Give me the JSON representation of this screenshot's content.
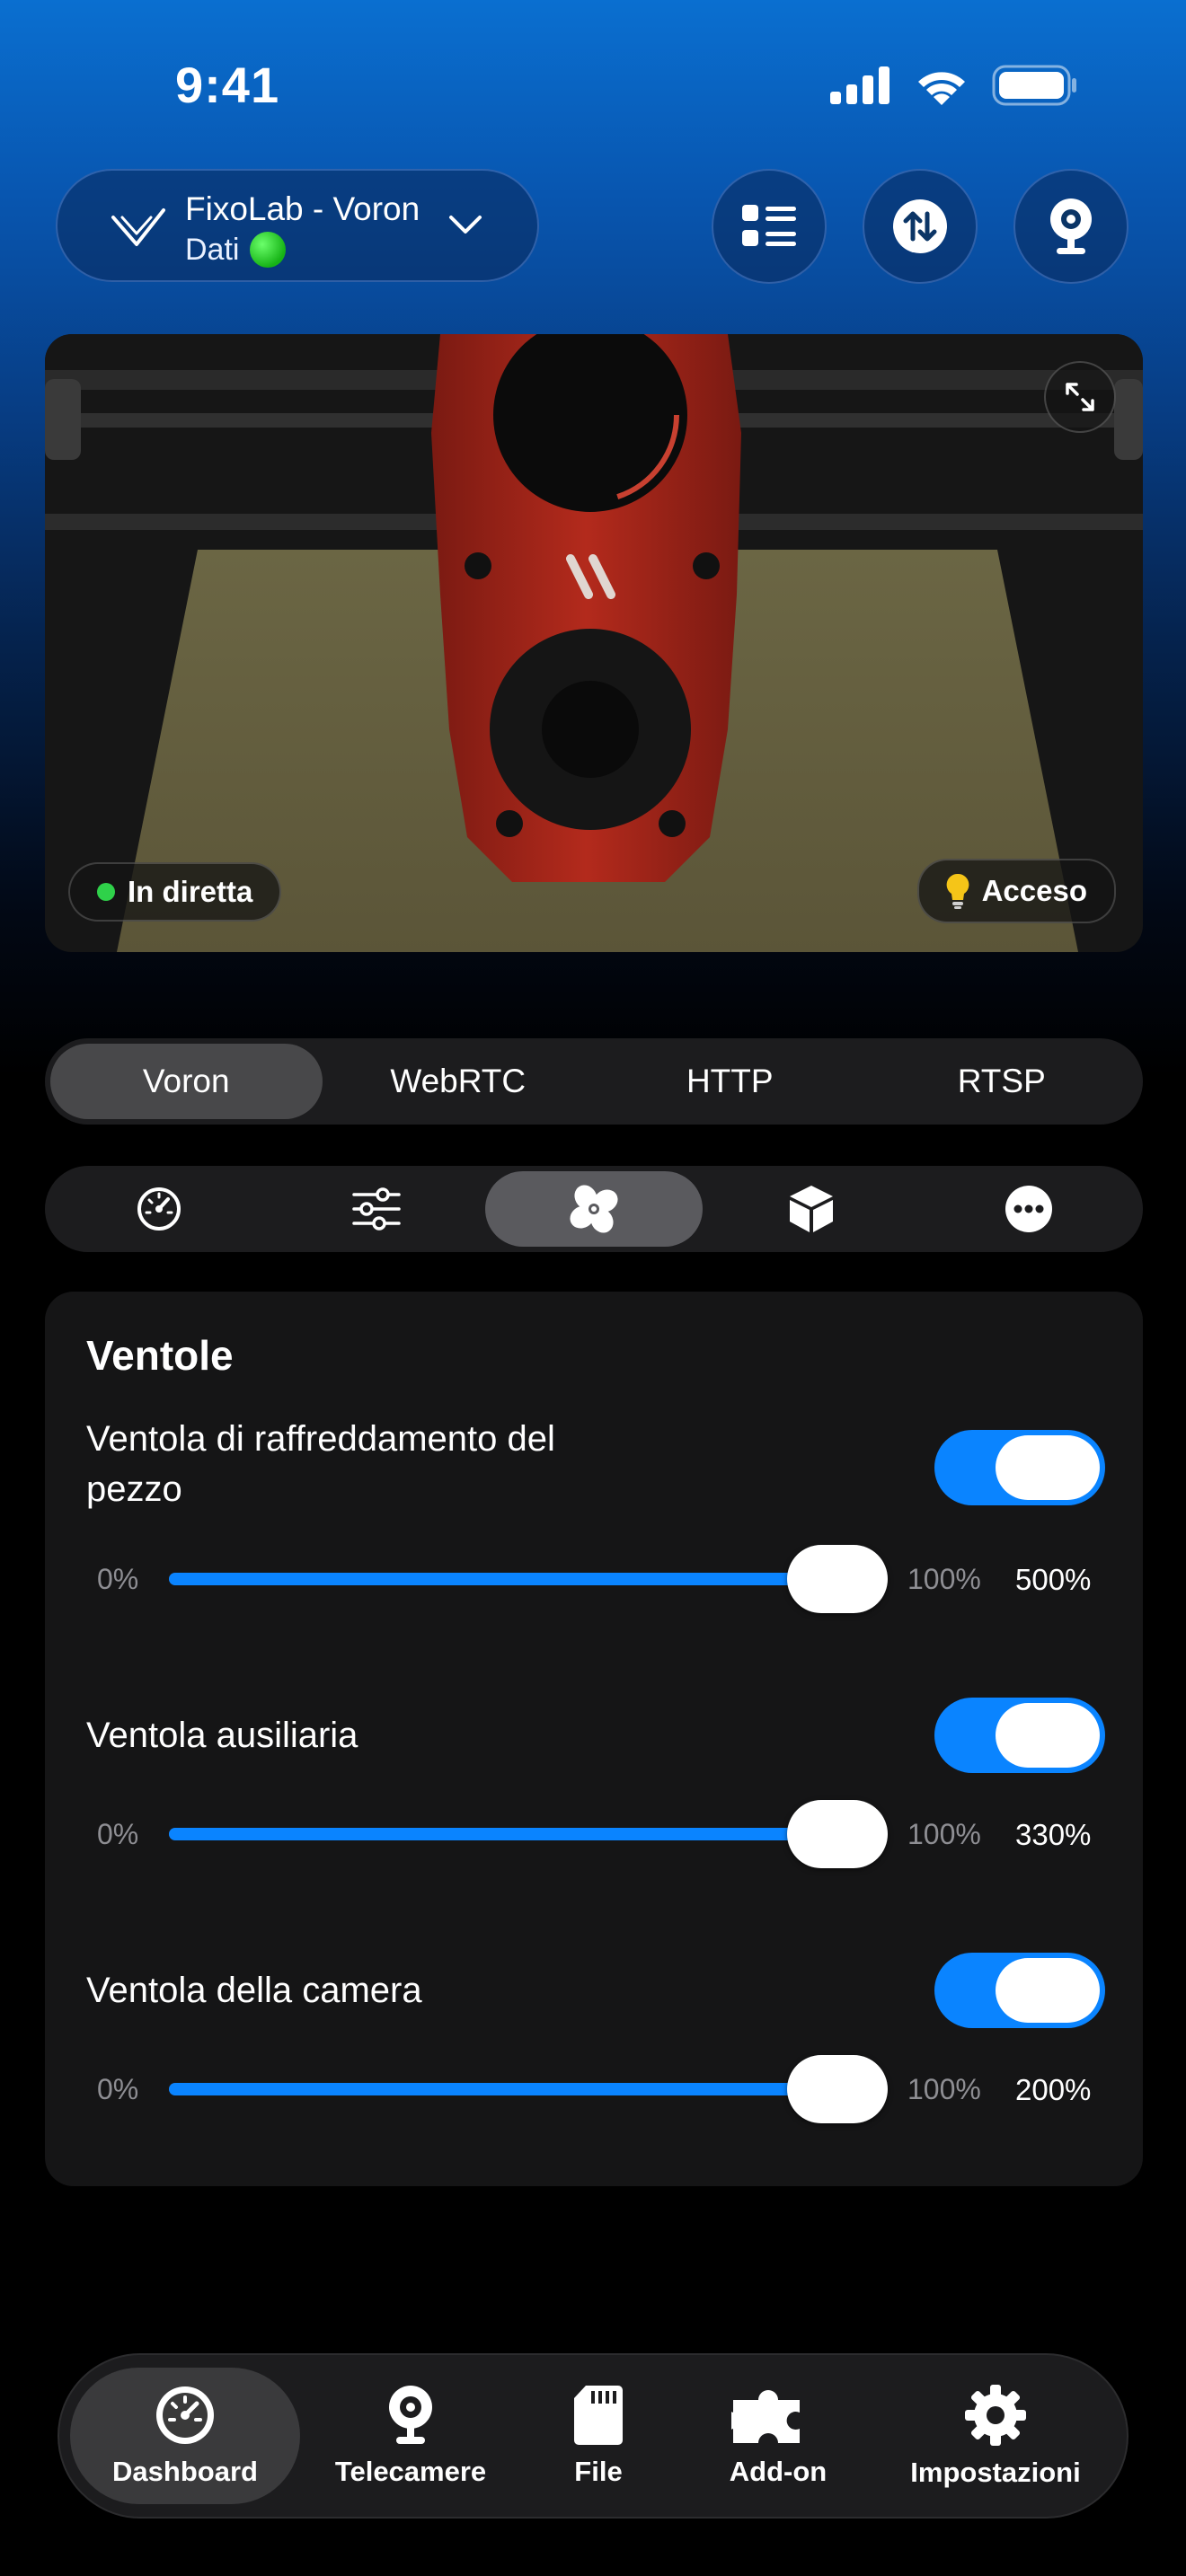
{
  "status_bar": {
    "time": "9:41"
  },
  "header": {
    "printer_name": "FixoLab - Voron",
    "printer_status": "Dati"
  },
  "camera": {
    "live_label": "In diretta",
    "light_label": "Acceso"
  },
  "source_tabs": [
    {
      "label": "Voron",
      "active": true
    },
    {
      "label": "WebRTC",
      "active": false
    },
    {
      "label": "HTTP",
      "active": false
    },
    {
      "label": "RTSP",
      "active": false
    }
  ],
  "section_tabs": [
    {
      "icon": "speedometer-icon",
      "active": false
    },
    {
      "icon": "sliders-icon",
      "active": false
    },
    {
      "icon": "fan-icon",
      "active": true
    },
    {
      "icon": "cube-icon",
      "active": false
    },
    {
      "icon": "more-icon",
      "active": false
    }
  ],
  "fans": {
    "title": "Ventole",
    "items": [
      {
        "label": "Ventola di raffreddamento del pezzo",
        "enabled": true,
        "min": "0%",
        "max": "100%",
        "value": "500%",
        "level": 1.0
      },
      {
        "label": "Ventola ausiliaria",
        "enabled": true,
        "min": "0%",
        "max": "100%",
        "value": "330%",
        "level": 1.0
      },
      {
        "label": "Ventola della camera",
        "enabled": true,
        "min": "0%",
        "max": "100%",
        "value": "200%",
        "level": 1.0
      }
    ]
  },
  "nav": [
    {
      "label": "Dashboard",
      "icon": "dashboard-gauge-icon",
      "active": true
    },
    {
      "label": "Telecamere",
      "icon": "webcam-icon",
      "active": false
    },
    {
      "label": "File",
      "icon": "sd-card-icon",
      "active": false
    },
    {
      "label": "Add-on",
      "icon": "puzzle-icon",
      "active": false
    },
    {
      "label": "Impostazioni",
      "icon": "gear-icon",
      "active": false
    }
  ],
  "colors": {
    "accent": "#0a84ff",
    "card": "#151516",
    "status_green": "#16b316"
  }
}
